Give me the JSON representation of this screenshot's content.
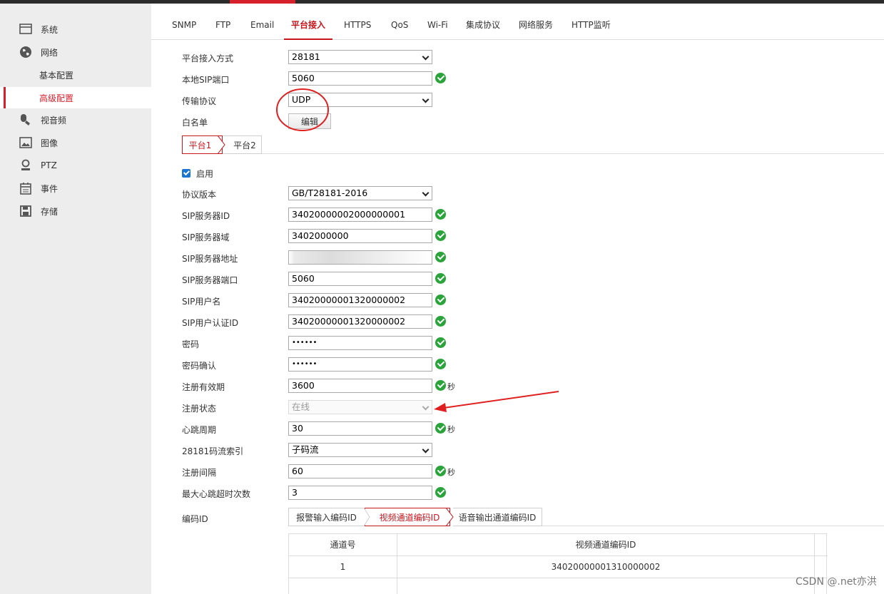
{
  "sidebar": {
    "items": [
      {
        "label": "系统",
        "icon": "monitor-icon"
      },
      {
        "label": "网络",
        "icon": "globe-icon"
      },
      {
        "label": "基本配置"
      },
      {
        "label": "高级配置"
      },
      {
        "label": "视音频",
        "icon": "microphone-icon"
      },
      {
        "label": "图像",
        "icon": "image-icon"
      },
      {
        "label": "PTZ",
        "icon": "camera-person-icon"
      },
      {
        "label": "事件",
        "icon": "calendar-icon"
      },
      {
        "label": "存储",
        "icon": "floppy-disk-icon"
      }
    ]
  },
  "tabs": [
    "SNMP",
    "FTP",
    "Email",
    "平台接入",
    "HTTPS",
    "QoS",
    "Wi-Fi",
    "集成协议",
    "网络服务",
    "HTTP监听"
  ],
  "general": {
    "access_mode_label": "平台接入方式",
    "access_mode_value": "28181",
    "sip_port_label": "本地SIP端口",
    "sip_port_value": "5060",
    "transport_label": "传输协议",
    "transport_value": "UDP",
    "whitelist_label": "白名单",
    "edit_button": "编辑"
  },
  "platform_tabs": [
    "平台1",
    "平台2"
  ],
  "enable_label": "启用",
  "fields": {
    "protocol_version": {
      "label": "协议版本",
      "value": "GB/T28181-2016"
    },
    "sip_server_id": {
      "label": "SIP服务器ID",
      "value": "34020000002000000001"
    },
    "sip_server_domain": {
      "label": "SIP服务器域",
      "value": "3402000000"
    },
    "sip_server_address": {
      "label": "SIP服务器地址",
      "value": ""
    },
    "sip_server_port": {
      "label": "SIP服务器端口",
      "value": "5060"
    },
    "sip_username": {
      "label": "SIP用户名",
      "value": "34020000001320000002"
    },
    "sip_auth_id": {
      "label": "SIP用户认证ID",
      "value": "34020000001320000002"
    },
    "password": {
      "label": "密码",
      "value": "••••••"
    },
    "password_confirm": {
      "label": "密码确认",
      "value": "••••••"
    },
    "register_validity": {
      "label": "注册有效期",
      "value": "3600",
      "unit": "秒"
    },
    "register_status": {
      "label": "注册状态",
      "value": "在线"
    },
    "heartbeat_period": {
      "label": "心跳周期",
      "value": "30",
      "unit": "秒"
    },
    "stream_index": {
      "label": "28181码流索引",
      "value": "子码流"
    },
    "register_interval": {
      "label": "注册间隔",
      "value": "60",
      "unit": "秒"
    },
    "max_heartbeat_timeouts": {
      "label": "最大心跳超时次数",
      "value": "3"
    }
  },
  "encoding": {
    "label": "编码ID",
    "tabs": [
      "报警输入编码ID",
      "视频通道编码ID",
      "语音输出通道编码ID"
    ],
    "table": {
      "headers": [
        "通道号",
        "视频通道编码ID"
      ],
      "rows": [
        [
          "1",
          "34020000001310000002"
        ]
      ]
    }
  },
  "watermark": "CSDN @.net亦洪",
  "colors": {
    "accent": "#c8161d",
    "ok": "#2aa43a",
    "annotation": "#e02020"
  }
}
